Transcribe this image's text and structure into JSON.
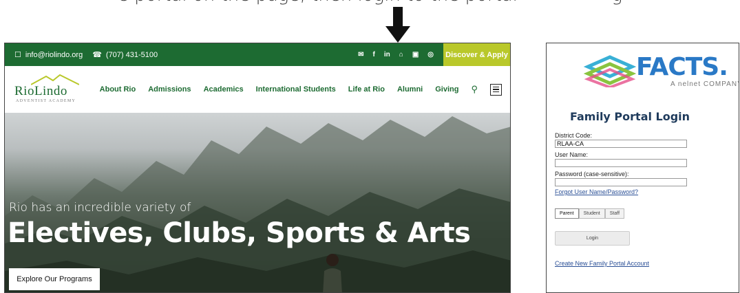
{
  "caption": {
    "left_text": "e portal on the page, then login to the portal",
    "right_text": "g"
  },
  "site": {
    "topbar": {
      "email": "info@riolindo.org",
      "phone": "(707) 431-5100",
      "social_icons": [
        "mail-icon",
        "facebook-icon",
        "linkedin-icon",
        "graduation-cap-icon",
        "youtube-icon",
        "instagram-icon"
      ],
      "social_glyphs": [
        "✉",
        "f",
        "in",
        "⌂",
        "▣",
        "◎"
      ],
      "cta": "Discover & Apply"
    },
    "logo": {
      "name": "RioLindo",
      "subtitle": "ADVENTIST ACADEMY"
    },
    "nav": [
      "About Rio",
      "Admissions",
      "Academics",
      "International Students",
      "Life at Rio",
      "Alumni",
      "Giving"
    ],
    "hero": {
      "lead": "Rio has an incredible variety of",
      "headline": "Electives, Clubs, Sports & Arts",
      "button": "Explore Our Programs"
    },
    "colors": {
      "brand_green": "#1d6b32",
      "cta_lime": "#b9c82a"
    }
  },
  "facts": {
    "brand": "FACTS.",
    "tagline": "A nelnet COMPANY",
    "title": "Family Portal Login",
    "district_label": "District Code:",
    "district_value": "RLAA-CA",
    "username_label": "User Name:",
    "username_value": "",
    "password_label": "Password (case-sensitive):",
    "password_value": "",
    "forgot_link": "Forgot User Name/Password?",
    "roles": [
      "Parent",
      "Student",
      "Staff"
    ],
    "selected_role": "Parent",
    "login_button": "Login",
    "create_link": "Create New Family Portal Account"
  }
}
